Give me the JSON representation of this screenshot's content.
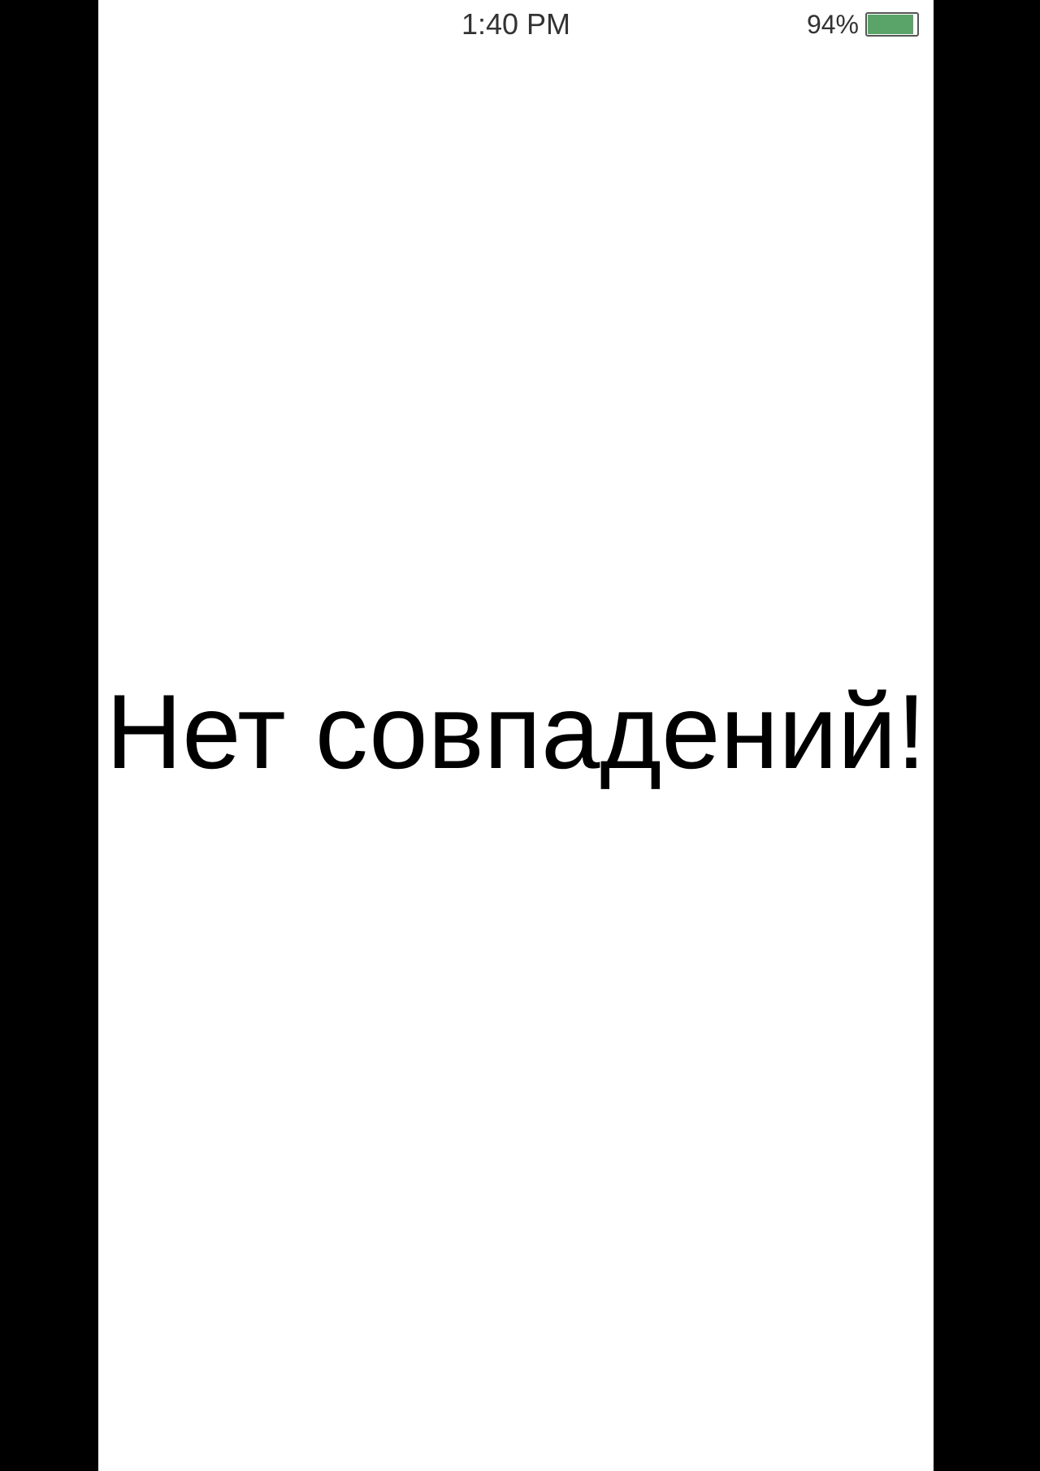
{
  "status_bar": {
    "time": "1:40 PM",
    "battery_percent": "94%",
    "battery_level": 0.94,
    "battery_icon": "battery-icon",
    "battery_color": "#5aa46a"
  },
  "main": {
    "message": "Нет совпадений!"
  }
}
